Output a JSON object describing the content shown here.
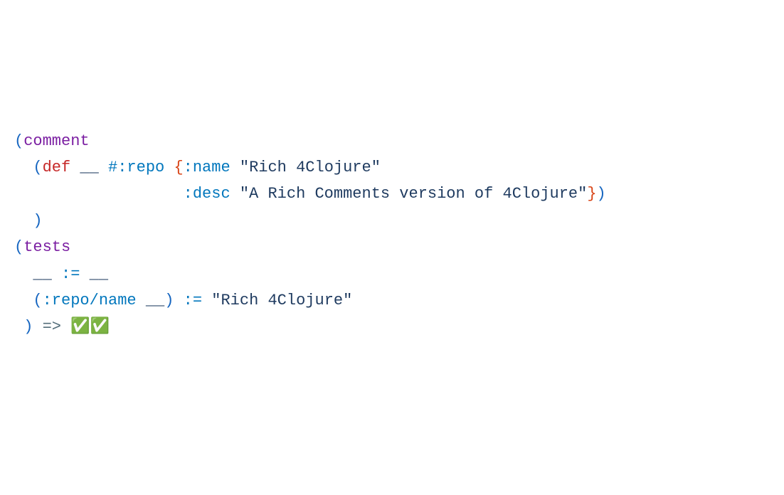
{
  "code": {
    "line1": {
      "paren_open": "(",
      "comment": "comment"
    },
    "line2": {
      "indent": "  ",
      "paren_open": "(",
      "def": "def",
      "sp1": " ",
      "blank": "__",
      "sp2": " ",
      "hash_repo": "#:repo",
      "sp3": " ",
      "brace_open": "{",
      "key_name": ":name",
      "sp4": " ",
      "str_name": "\"Rich 4Clojure\""
    },
    "line3": {
      "indent": "                  ",
      "key_desc": ":desc",
      "sp1": " ",
      "str_desc": "\"A Rich Comments version of 4Clojure\"",
      "brace_close": "}",
      "paren_close": ")"
    },
    "line4": {
      "indent": "  ",
      "paren_close": ")"
    },
    "blank_line": "",
    "line5": {
      "paren_open": "(",
      "tests": "tests"
    },
    "line6": {
      "indent": "  ",
      "blank1": "__",
      "sp1": " ",
      "assign": ":=",
      "sp2": " ",
      "blank2": "__"
    },
    "line7": {
      "indent": "  ",
      "paren_open": "(",
      "key_repo_name": ":repo/name",
      "sp1": " ",
      "blank": "__",
      "paren_close": ")",
      "sp2": " ",
      "assign": ":=",
      "sp3": " ",
      "str": "\"Rich 4Clojure\""
    },
    "line8": {
      "indent": " ",
      "paren_close": ")",
      "sp1": " ",
      "arrow": "=>",
      "sp2": " ",
      "checks": "✅✅"
    }
  }
}
